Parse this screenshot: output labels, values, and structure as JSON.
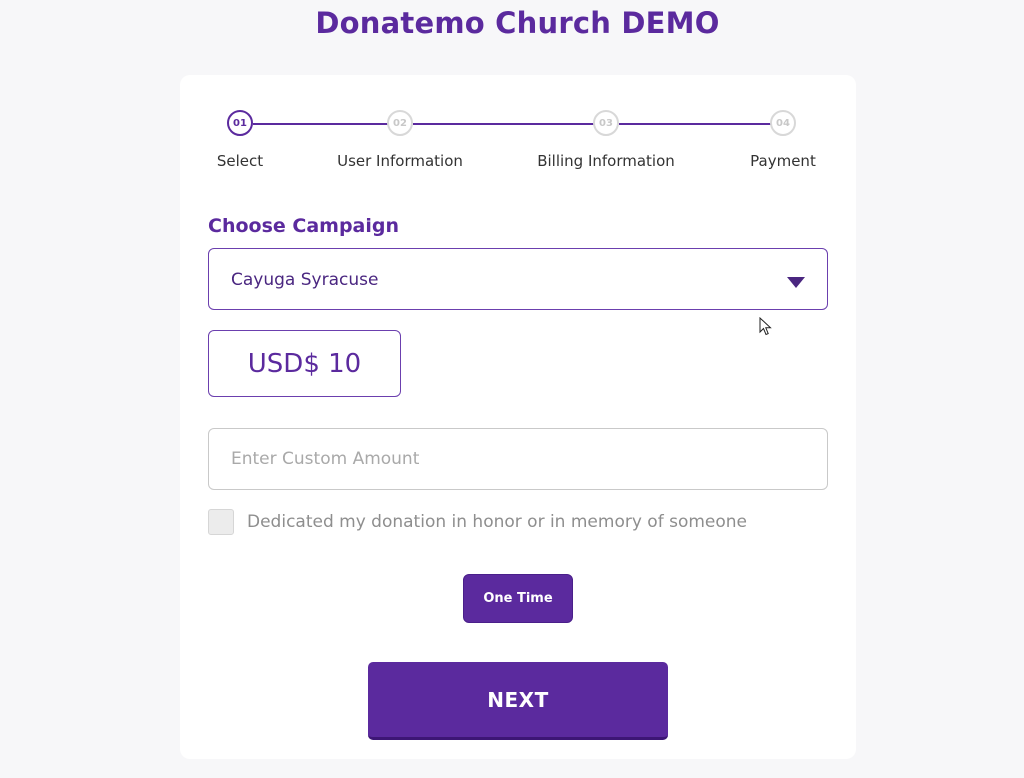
{
  "page": {
    "title": "Donatemo Church DEMO"
  },
  "stepper": {
    "steps": [
      {
        "number": "01",
        "label": "Select",
        "state": "active"
      },
      {
        "number": "02",
        "label": "User Information",
        "state": "inactive"
      },
      {
        "number": "03",
        "label": "Billing Information",
        "state": "inactive"
      },
      {
        "number": "04",
        "label": "Payment",
        "state": "inactive"
      }
    ]
  },
  "campaign": {
    "label": "Choose Campaign",
    "selected": "Cayuga Syracuse",
    "dropdown_icon": "caret-down-icon"
  },
  "amount": {
    "preset": "USD$ 10",
    "custom_placeholder": "Enter Custom Amount"
  },
  "dedication": {
    "label": "Dedicated my donation in honor or in memory of someone",
    "checked": false
  },
  "frequency": {
    "label": "One Time"
  },
  "actions": {
    "next_label": "NEXT"
  },
  "colors": {
    "brand": "#5b2a9e",
    "background": "#f7f7f9",
    "card": "#ffffff"
  }
}
